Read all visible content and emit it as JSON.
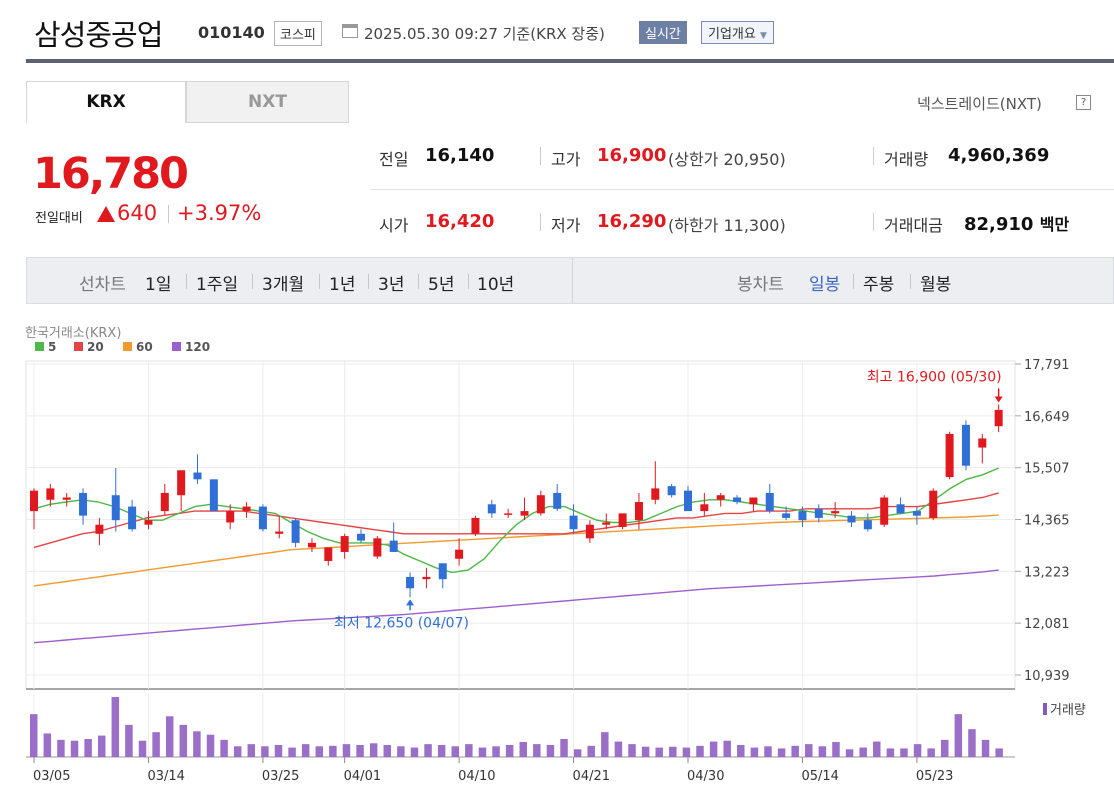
{
  "header": {
    "company_name": "삼성중공업",
    "code": "010140",
    "market": "코스피",
    "datetime": "2025.05.30 09:27",
    "basis": "기준(KRX 장중)",
    "realtime_label": "실시간",
    "overview_label": "기업개요"
  },
  "market_tabs": {
    "krx": "KRX",
    "nxt": "NXT",
    "nxt_link": "넥스트레이드(NXT)",
    "help": "?"
  },
  "price": {
    "current": "16,780",
    "change_label": "전일대비",
    "change_amount": "640",
    "change_rate": "+3.97%",
    "up_color": "#e0191f"
  },
  "stats": {
    "prev_close_label": "전일",
    "prev_close": "16,140",
    "high_label": "고가",
    "high": "16,900",
    "upper_limit": "(상한가 20,950)",
    "volume_label": "거래량",
    "volume": "4,960,369",
    "open_label": "시가",
    "open": "16,420",
    "low_label": "저가",
    "low": "16,290",
    "lower_limit": "(하한가 11,300)",
    "value_label": "거래대금",
    "value": "82,910",
    "value_unit": "백만"
  },
  "toolbar": {
    "line_chart_label": "선차트",
    "periods": [
      "1일",
      "1주일",
      "3개월",
      "1년",
      "3년",
      "5년",
      "10년"
    ],
    "candle_chart_label": "봉차트",
    "candle_types": [
      "일봉",
      "주봉",
      "월봉"
    ],
    "active_candle": "일봉"
  },
  "chart_data": {
    "type": "candlestick",
    "source_label": "한국거래소(KRX)",
    "ma_legend": [
      {
        "name": "5",
        "color": "#4cb848"
      },
      {
        "name": "20",
        "color": "#e64444"
      },
      {
        "name": "60",
        "color": "#f39a2e"
      },
      {
        "name": "120",
        "color": "#9d5fcf"
      }
    ],
    "y_ticks": [
      17791,
      16649,
      15507,
      14365,
      13223,
      12081,
      10939
    ],
    "y_tick_labels": [
      "17,791",
      "16,649",
      "15,507",
      "14,365",
      "13,223",
      "12,081",
      "10,939"
    ],
    "ylim": [
      10900,
      17850
    ],
    "x_tick_labels": [
      {
        "label": "03/05",
        "index": 0
      },
      {
        "label": "03/14",
        "index": 7
      },
      {
        "label": "03/25",
        "index": 14
      },
      {
        "label": "04/01",
        "index": 19
      },
      {
        "label": "04/10",
        "index": 26
      },
      {
        "label": "04/21",
        "index": 33
      },
      {
        "label": "04/30",
        "index": 40
      },
      {
        "label": "05/14",
        "index": 47
      },
      {
        "label": "05/23",
        "index": 54
      }
    ],
    "candles": [
      {
        "o": 14550,
        "h": 15050,
        "l": 14150,
        "c": 15000
      },
      {
        "o": 14800,
        "h": 15150,
        "l": 14650,
        "c": 15050
      },
      {
        "o": 14800,
        "h": 14950,
        "l": 14650,
        "c": 14850
      },
      {
        "o": 14950,
        "h": 15050,
        "l": 14250,
        "c": 14450
      },
      {
        "o": 14050,
        "h": 14400,
        "l": 13800,
        "c": 14250
      },
      {
        "o": 14900,
        "h": 15500,
        "l": 14100,
        "c": 14350
      },
      {
        "o": 14650,
        "h": 14800,
        "l": 14100,
        "c": 14150
      },
      {
        "o": 14250,
        "h": 14550,
        "l": 14150,
        "c": 14350
      },
      {
        "o": 14550,
        "h": 15150,
        "l": 14450,
        "c": 14950
      },
      {
        "o": 14900,
        "h": 15350,
        "l": 14550,
        "c": 15450
      },
      {
        "o": 15400,
        "h": 15800,
        "l": 15150,
        "c": 15250
      },
      {
        "o": 15250,
        "h": 15250,
        "l": 14550,
        "c": 14550
      },
      {
        "o": 14300,
        "h": 14700,
        "l": 14150,
        "c": 14550
      },
      {
        "o": 14550,
        "h": 14750,
        "l": 14400,
        "c": 14650
      },
      {
        "o": 14650,
        "h": 14700,
        "l": 14100,
        "c": 14150
      },
      {
        "o": 14050,
        "h": 14450,
        "l": 13950,
        "c": 14100
      },
      {
        "o": 14350,
        "h": 14400,
        "l": 13750,
        "c": 13850
      },
      {
        "o": 13750,
        "h": 13950,
        "l": 13650,
        "c": 13850
      },
      {
        "o": 13450,
        "h": 13750,
        "l": 13350,
        "c": 13750
      },
      {
        "o": 13650,
        "h": 14050,
        "l": 13500,
        "c": 14000
      },
      {
        "o": 14050,
        "h": 14150,
        "l": 13850,
        "c": 13900
      },
      {
        "o": 13550,
        "h": 14000,
        "l": 13500,
        "c": 13950
      },
      {
        "o": 13900,
        "h": 14300,
        "l": 13650,
        "c": 13650
      },
      {
        "o": 13100,
        "h": 13200,
        "l": 12650,
        "c": 12850
      },
      {
        "o": 13050,
        "h": 13300,
        "l": 12850,
        "c": 13100
      },
      {
        "o": 13400,
        "h": 13400,
        "l": 12850,
        "c": 13050
      },
      {
        "o": 13500,
        "h": 13950,
        "l": 13350,
        "c": 13700
      },
      {
        "o": 14050,
        "h": 14450,
        "l": 14000,
        "c": 14400
      },
      {
        "o": 14700,
        "h": 14800,
        "l": 14400,
        "c": 14500
      },
      {
        "o": 14500,
        "h": 14600,
        "l": 14400,
        "c": 14500
      },
      {
        "o": 14450,
        "h": 14850,
        "l": 14350,
        "c": 14550
      },
      {
        "o": 14500,
        "h": 15000,
        "l": 14450,
        "c": 14900
      },
      {
        "o": 14950,
        "h": 15150,
        "l": 14550,
        "c": 14600
      },
      {
        "o": 14450,
        "h": 14700,
        "l": 14050,
        "c": 14150
      },
      {
        "o": 13950,
        "h": 14350,
        "l": 13850,
        "c": 14250
      },
      {
        "o": 14250,
        "h": 14500,
        "l": 14150,
        "c": 14300
      },
      {
        "o": 14200,
        "h": 14500,
        "l": 14150,
        "c": 14500
      },
      {
        "o": 14350,
        "h": 14950,
        "l": 14150,
        "c": 14750
      },
      {
        "o": 14800,
        "h": 15650,
        "l": 14700,
        "c": 15050
      },
      {
        "o": 15100,
        "h": 15150,
        "l": 14850,
        "c": 14900
      },
      {
        "o": 15000,
        "h": 15100,
        "l": 14600,
        "c": 14550
      },
      {
        "o": 14550,
        "h": 14950,
        "l": 14450,
        "c": 14700
      },
      {
        "o": 14800,
        "h": 14950,
        "l": 14650,
        "c": 14900
      },
      {
        "o": 14850,
        "h": 14900,
        "l": 14700,
        "c": 14750
      },
      {
        "o": 14700,
        "h": 14850,
        "l": 14550,
        "c": 14850
      },
      {
        "o": 14950,
        "h": 15150,
        "l": 14500,
        "c": 14550
      },
      {
        "o": 14500,
        "h": 14650,
        "l": 14350,
        "c": 14400
      },
      {
        "o": 14550,
        "h": 14650,
        "l": 14200,
        "c": 14350
      },
      {
        "o": 14600,
        "h": 14700,
        "l": 14300,
        "c": 14400
      },
      {
        "o": 14500,
        "h": 14750,
        "l": 14400,
        "c": 14550
      },
      {
        "o": 14450,
        "h": 14550,
        "l": 14200,
        "c": 14300
      },
      {
        "o": 14350,
        "h": 14500,
        "l": 14100,
        "c": 14150
      },
      {
        "o": 14250,
        "h": 14900,
        "l": 14200,
        "c": 14850
      },
      {
        "o": 14700,
        "h": 14850,
        "l": 14500,
        "c": 14500
      },
      {
        "o": 14550,
        "h": 14650,
        "l": 14250,
        "c": 14450
      },
      {
        "o": 14400,
        "h": 15050,
        "l": 14350,
        "c": 15000
      },
      {
        "o": 15300,
        "h": 16300,
        "l": 15250,
        "c": 16250
      },
      {
        "o": 16450,
        "h": 16550,
        "l": 15450,
        "c": 15550
      },
      {
        "o": 15950,
        "h": 16250,
        "l": 15600,
        "c": 16150
      },
      {
        "o": 16420,
        "h": 16900,
        "l": 16290,
        "c": 16780
      }
    ],
    "moving_averages": {
      "5": [
        14600,
        14700,
        14750,
        14800,
        14750,
        14650,
        14500,
        14350,
        14350,
        14500,
        14650,
        14700,
        14650,
        14600,
        14550,
        14500,
        14300,
        14100,
        13950,
        13850,
        13850,
        13850,
        13800,
        13600,
        13450,
        13300,
        13200,
        13250,
        13500,
        13900,
        14250,
        14500,
        14650,
        14650,
        14500,
        14350,
        14300,
        14300,
        14350,
        14500,
        14650,
        14750,
        14800,
        14800,
        14750,
        14700,
        14650,
        14600,
        14550,
        14500,
        14450,
        14400,
        14400,
        14450,
        14500,
        14550,
        14800,
        15050,
        15250,
        15350,
        15500
      ],
      "20": [
        13750,
        13850,
        13950,
        14050,
        14100,
        14200,
        14300,
        14400,
        14450,
        14500,
        14550,
        14550,
        14550,
        14550,
        14500,
        14450,
        14400,
        14350,
        14300,
        14250,
        14200,
        14150,
        14100,
        14050,
        14050,
        14050,
        14050,
        14050,
        14050,
        14050,
        14050,
        14050,
        14050,
        14050,
        14100,
        14150,
        14200,
        14250,
        14300,
        14350,
        14400,
        14400,
        14450,
        14500,
        14500,
        14550,
        14550,
        14550,
        14600,
        14600,
        14600,
        14600,
        14600,
        14650,
        14650,
        14650,
        14700,
        14750,
        14800,
        14850,
        14950
      ],
      "60": [
        12900,
        12950,
        13000,
        13050,
        13100,
        13150,
        13200,
        13250,
        13300,
        13350,
        13400,
        13450,
        13500,
        13550,
        13600,
        13650,
        13700,
        13720,
        13740,
        13760,
        13780,
        13800,
        13820,
        13840,
        13860,
        13880,
        13900,
        13920,
        13940,
        13960,
        13980,
        14000,
        14020,
        14040,
        14060,
        14080,
        14100,
        14120,
        14140,
        14160,
        14180,
        14200,
        14220,
        14240,
        14260,
        14280,
        14300,
        14310,
        14320,
        14330,
        14340,
        14350,
        14360,
        14370,
        14380,
        14390,
        14400,
        14410,
        14420,
        14440,
        14460
      ],
      "120": [
        11650,
        11680,
        11710,
        11740,
        11770,
        11800,
        11830,
        11860,
        11890,
        11920,
        11950,
        11980,
        12010,
        12040,
        12070,
        12100,
        12130,
        12150,
        12170,
        12190,
        12210,
        12230,
        12250,
        12270,
        12300,
        12330,
        12360,
        12390,
        12420,
        12450,
        12480,
        12510,
        12540,
        12570,
        12600,
        12630,
        12660,
        12690,
        12720,
        12750,
        12780,
        12810,
        12840,
        12860,
        12880,
        12900,
        12920,
        12940,
        12960,
        12980,
        13000,
        13020,
        13040,
        13060,
        13080,
        13100,
        13120,
        13150,
        13180,
        13210,
        13250
      ]
    },
    "volume_label": "거래량",
    "volumes": [
      100,
      55,
      40,
      38,
      42,
      50,
      140,
      75,
      38,
      58,
      95,
      75,
      60,
      52,
      40,
      25,
      30,
      25,
      28,
      22,
      30,
      25,
      26,
      30,
      28,
      32,
      28,
      25,
      22,
      30,
      28,
      25,
      30,
      22,
      25,
      28,
      35,
      30,
      28,
      42,
      18,
      26,
      58,
      36,
      30,
      24,
      22,
      24,
      22,
      26,
      36,
      38,
      28,
      22,
      25,
      20,
      26,
      30,
      25,
      35,
      18,
      22,
      36,
      20,
      20,
      30,
      20,
      40,
      100,
      65,
      40,
      20
    ],
    "annotations": {
      "high_text": "최고 16,900 (05/30)",
      "high_index": 59,
      "high_value": 16900,
      "low_text": "최저 12,650 (04/07)",
      "low_index": 23,
      "low_value": 12650
    },
    "up_color": "#e0191f",
    "down_color": "#2f6fd6",
    "grid": true
  }
}
